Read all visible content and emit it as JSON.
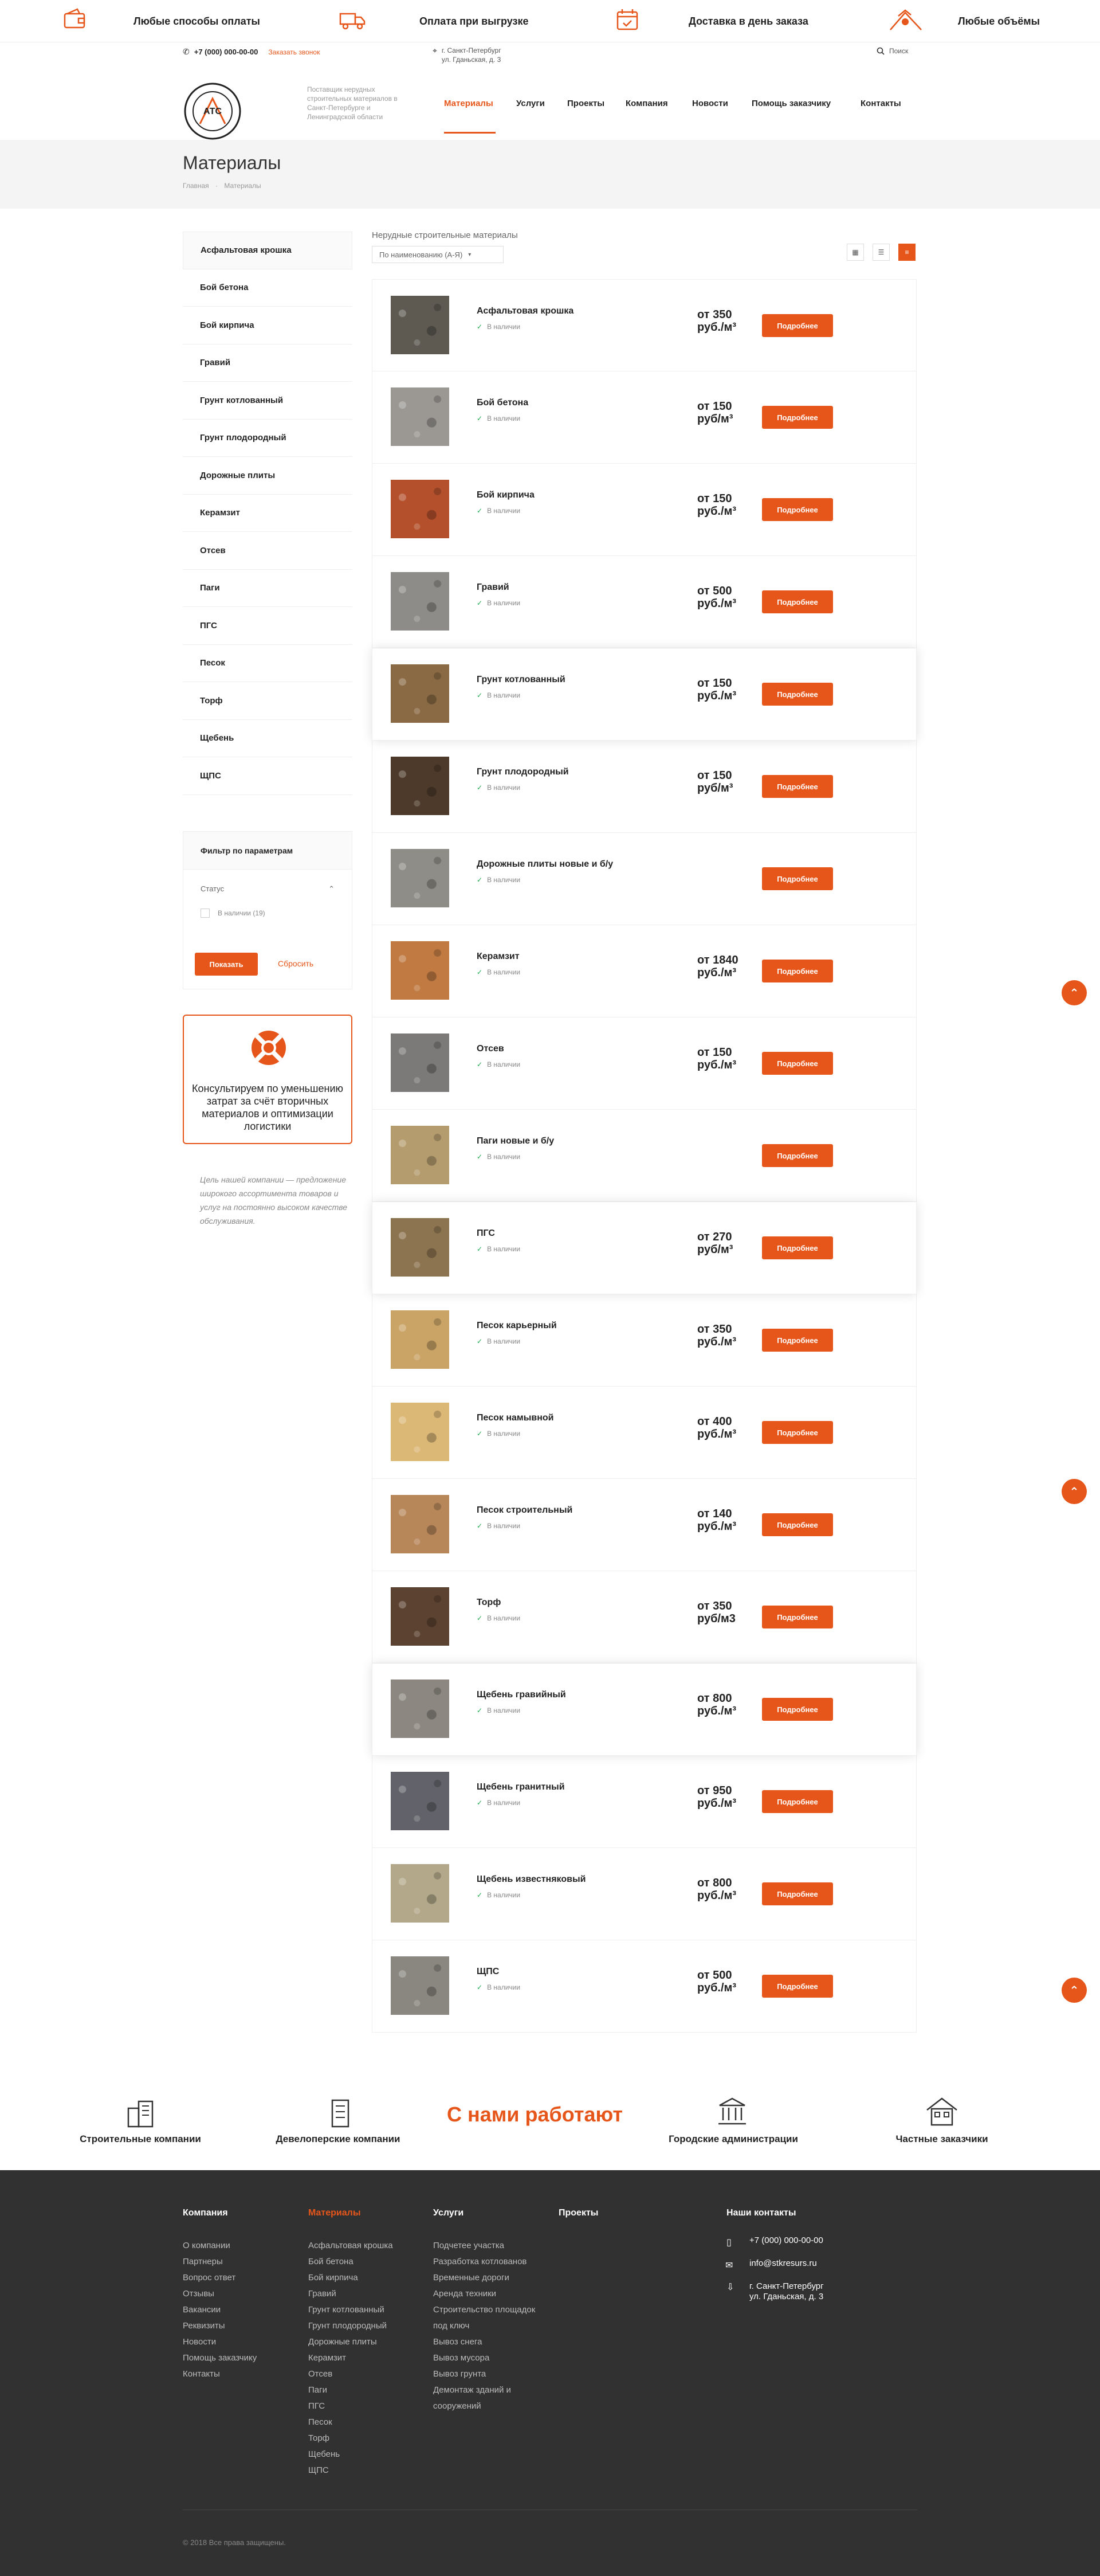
{
  "benefits": [
    {
      "label": "Любые способы оплаты",
      "icon": "wallet-icon"
    },
    {
      "label": "Оплата при выгрузке",
      "icon": "truck-icon"
    },
    {
      "label": "Доставка в день заказа",
      "icon": "calendar-icon"
    },
    {
      "label": "Любые объёмы",
      "icon": "excavator-icon"
    }
  ],
  "header": {
    "phone": "+7 (000) 000-00-00",
    "callback": "Заказать звонок",
    "address_line1": "г. Санкт-Петербург",
    "address_line2": "ул. Гданьская, д. 3",
    "search": "Поиск",
    "logo_text": "АТС",
    "tagline": "Поставщик нерудных строительных материалов в Санкт-Петербурге и Ленинградской области",
    "nav": [
      "Материалы",
      "Услуги",
      "Проекты",
      "Компания",
      "Новости",
      "Помощь заказчику",
      "Контакты"
    ]
  },
  "page": {
    "title": "Материалы",
    "breadcrumb_home": "Главная",
    "breadcrumb_current": "Материалы"
  },
  "sidebar": {
    "items": [
      "Асфальтовая крошка",
      "Бой бетона",
      "Бой кирпича",
      "Гравий",
      "Грунт котлованный",
      "Грунт плодородный",
      "Дорожные плиты",
      "Керамзит",
      "Отсев",
      "Паги",
      "ПГС",
      "Песок",
      "Торф",
      "Щебень",
      "ЩПС"
    ],
    "filter_title": "Фильтр по параметрам",
    "filter_status": "Статус",
    "filter_option": "В наличии (19)",
    "show_btn": "Показать",
    "reset_btn": "Сбросить",
    "consult": "Консультируем по уменьшению затрат за счёт вторичных материалов и оптимизации логистики",
    "mission": "Цель нашей компании — предложение широкого ассортимента товаров и услуг на постоянно высоком качестве обслуживания."
  },
  "catalog": {
    "label": "Нерудные строительные материалы",
    "sort": "По наименованию (А-Я)",
    "more_label": "Подробнее",
    "stock_label": "В наличии",
    "products": [
      {
        "name": "Асфальтовая крошка",
        "price": "от 350",
        "unit": "руб./м³",
        "color": "#5e5a52"
      },
      {
        "name": "Бой бетона",
        "price": "от 150",
        "unit": "руб/м³",
        "color": "#9b9893"
      },
      {
        "name": "Бой кирпича",
        "price": "от 150",
        "unit": "руб./м³",
        "color": "#b4502c"
      },
      {
        "name": "Гравий",
        "price": "от 500",
        "unit": "руб./м³",
        "color": "#8e8c88"
      },
      {
        "name": "Грунт котлованный",
        "price": "от 150",
        "unit": "руб./м³",
        "color": "#8a6a44"
      },
      {
        "name": "Грунт плодородный",
        "price": "от 150",
        "unit": "руб/м³",
        "color": "#4d3a2a"
      },
      {
        "name": "Дорожные плиты новые и б/у",
        "price": "",
        "unit": "",
        "color": "#8f8d87"
      },
      {
        "name": "Керамзит",
        "price": "от 1840",
        "unit": "руб./м³",
        "color": "#c07a42"
      },
      {
        "name": "Отсев",
        "price": "от 150",
        "unit": "руб./м³",
        "color": "#7c7a78"
      },
      {
        "name": "Паги новые и б/у",
        "price": "",
        "unit": "",
        "color": "#b59c6e"
      },
      {
        "name": "ПГС",
        "price": "от 270",
        "unit": "руб/м³",
        "color": "#8d7450"
      },
      {
        "name": "Песок карьерный",
        "price": "от 350",
        "unit": "руб./м³",
        "color": "#caa466"
      },
      {
        "name": "Песок намывной",
        "price": "от 400",
        "unit": "руб./м³",
        "color": "#dcb877"
      },
      {
        "name": "Песок строительный",
        "price": "от 140",
        "unit": "руб./м³",
        "color": "#b7875a"
      },
      {
        "name": "Торф",
        "price": "от 350",
        "unit": "руб/м3",
        "color": "#5c4230"
      },
      {
        "name": "Щебень гравийный",
        "price": "от 800",
        "unit": "руб./м³",
        "color": "#8c8780"
      },
      {
        "name": "Щебень гранитный",
        "price": "от 950",
        "unit": "руб./м³",
        "color": "#62636a"
      },
      {
        "name": "Щебень известняковый",
        "price": "от 800",
        "unit": "руб./м³",
        "color": "#b3a98a"
      },
      {
        "name": "ЩПС",
        "price": "от 500",
        "unit": "руб./м³",
        "color": "#8a8780"
      }
    ]
  },
  "clients": {
    "title": "С нами работают",
    "items": [
      "Строительные компании",
      "Девелоперские компании",
      "Городские администрации",
      "Частные заказчики"
    ]
  },
  "footer": {
    "company_head": "Компания",
    "company_links": [
      "О компании",
      "Партнеры",
      "Вопрос ответ",
      "Отзывы",
      "Вакансии",
      "Реквизиты",
      "Новости",
      "Помощь заказчику",
      "Контакты"
    ],
    "materials_head": "Материалы",
    "materials_links": [
      "Асфальтовая крошка",
      "Бой бетона",
      "Бой кирпича",
      "Гравий",
      "Грунт котлованный",
      "Грунт плодородный",
      "Дорожные плиты",
      "Керамзит",
      "Отсев",
      "Паги",
      "ПГС",
      "Песок",
      "Торф",
      "Щебень",
      "ЩПС"
    ],
    "services_head": "Услуги",
    "services_links": [
      "Подчетее участка",
      "Разработка котлованов",
      "Временные дороги",
      "Аренда техники",
      "Строительство площадок под ключ",
      "Вывоз снега",
      "Вывоз мусора",
      "Вывоз грунта",
      "Демонтаж зданий и сооружений"
    ],
    "projects_head": "Проекты",
    "contacts_head": "Наши контакты",
    "phone": "+7 (000) 000-00-00",
    "email": "info@stkresurs.ru",
    "address_line1": "г. Санкт-Петербург",
    "address_line2": "ул. Гданьская, д. 3",
    "copyright": "© 2018 Все права защищены."
  },
  "colors": {
    "accent": "#e6561a",
    "footer": "#313131",
    "band": "#f4f4f4"
  }
}
